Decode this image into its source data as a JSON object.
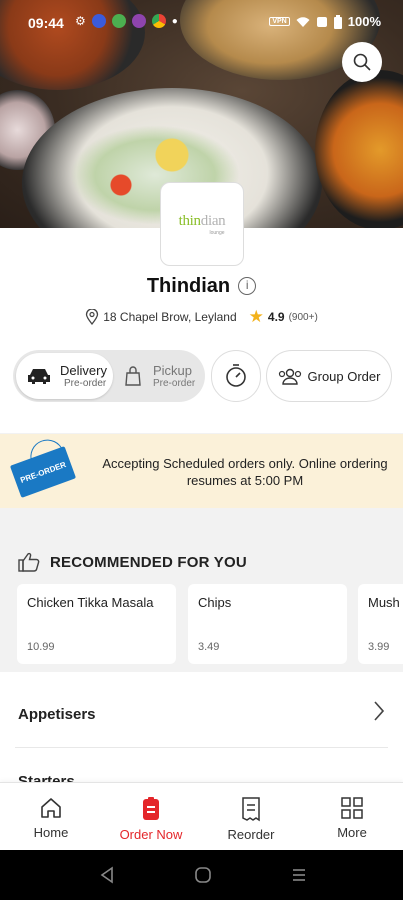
{
  "status_bar": {
    "time": "09:44",
    "battery": "100%",
    "vpn": "VPN"
  },
  "restaurant": {
    "logo_brand_main": "thin",
    "logo_brand_accent": "dian",
    "logo_sub": "lounge",
    "name": "Thindian",
    "address": "18 Chapel Brow, Leyland",
    "rating": "4.9",
    "rating_count": "(900+)"
  },
  "order_mode": {
    "delivery": {
      "label": "Delivery",
      "sub": "Pre-order",
      "selected": true
    },
    "pickup": {
      "label": "Pickup",
      "sub": "Pre-order",
      "selected": false
    }
  },
  "group_order_label": "Group Order",
  "banner": {
    "tag": "PRE-ORDER",
    "text": "Accepting Scheduled orders only. Online ordering resumes at 5:00 PM"
  },
  "recommended": {
    "title": "RECOMMENDED FOR YOU",
    "items": [
      {
        "name": "Chicken Tikka Masala",
        "price": "10.99"
      },
      {
        "name": "Chips",
        "price": "3.49"
      },
      {
        "name": "Mush",
        "price": "3.99"
      }
    ]
  },
  "menu_categories": [
    "Appetisers",
    "Starters"
  ],
  "bottom_nav": {
    "home": "Home",
    "order_now": "Order Now",
    "reorder": "Reorder",
    "more": "More"
  },
  "colors": {
    "accent": "#e4262a",
    "banner_bg": "#fbf1d9",
    "tag_blue": "#1a79c4",
    "star": "#f3b21b",
    "logo_green": "#8bbf2b"
  },
  "icons": [
    "search-icon",
    "info-icon",
    "location-pin-icon",
    "star-icon",
    "car-icon",
    "bag-icon",
    "timer-icon",
    "group-icon",
    "thumbs-up-icon",
    "chevron-right-icon",
    "home-icon",
    "order-icon",
    "receipt-icon",
    "grid-icon"
  ]
}
